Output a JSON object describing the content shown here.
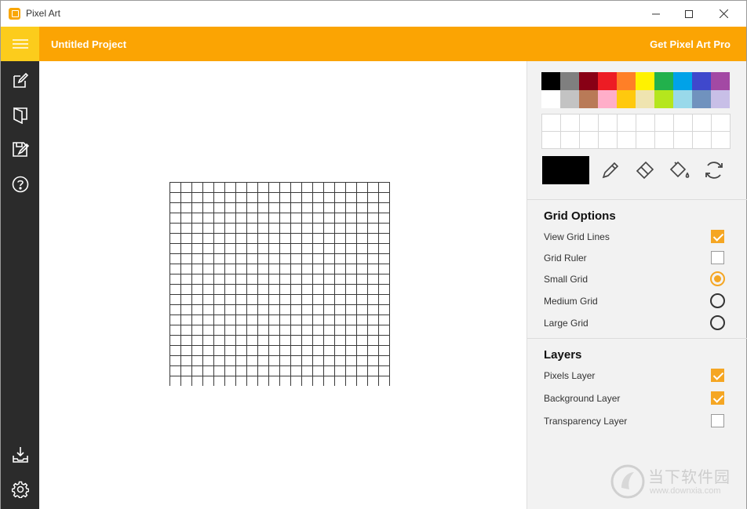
{
  "window": {
    "title": "Pixel Art",
    "controls": {
      "minimize": "minimize-icon",
      "maximize": "maximize-icon",
      "close": "close-icon"
    }
  },
  "header": {
    "menu_icon": "hamburger-menu-icon",
    "project_title": "Untitled Project",
    "pro_link": "Get Pixel Art Pro"
  },
  "sidebar": {
    "items": [
      {
        "icon": "edit-icon"
      },
      {
        "icon": "open-book-icon"
      },
      {
        "icon": "save-icon"
      },
      {
        "icon": "help-icon"
      },
      {
        "icon": "download-icon"
      },
      {
        "icon": "settings-gear-icon"
      }
    ]
  },
  "canvas": {
    "grid_columns": 20,
    "grid_rows": 20
  },
  "palette": {
    "colors": [
      "#000000",
      "#7f7f7f",
      "#880015",
      "#ed1c24",
      "#ff7f27",
      "#fff200",
      "#22b14c",
      "#00a2e8",
      "#3f48cc",
      "#a349a4",
      "#ffffff",
      "#c3c3c3",
      "#b97a57",
      "#ffaec9",
      "#ffc90e",
      "#efe4b0",
      "#b5e61d",
      "#99d9ea",
      "#7092be",
      "#c8bfe7"
    ],
    "current_color": "#000000"
  },
  "tools": [
    {
      "icon": "pencil-icon"
    },
    {
      "icon": "eraser-icon"
    },
    {
      "icon": "fill-bucket-icon"
    },
    {
      "icon": "refresh-icon"
    }
  ],
  "grid_options": {
    "title": "Grid Options",
    "view_grid_lines": {
      "label": "View Grid Lines",
      "checked": true
    },
    "grid_ruler": {
      "label": "Grid Ruler",
      "checked": false
    },
    "small_grid": {
      "label": "Small Grid",
      "selected": true
    },
    "medium_grid": {
      "label": "Medium Grid",
      "selected": false
    },
    "large_grid": {
      "label": "Large Grid",
      "selected": false
    }
  },
  "layers": {
    "title": "Layers",
    "pixels_layer": {
      "label": "Pixels Layer",
      "checked": true
    },
    "background_layer": {
      "label": "Background Layer",
      "checked": true
    },
    "transparency_layer": {
      "label": "Transparency Layer",
      "checked": false
    }
  },
  "watermark": {
    "text_cn": "当下软件园",
    "url": "www.downxia.com"
  },
  "colors": {
    "accent": "#fba403",
    "menu_button": "#fccc1c",
    "sidebar": "#2b2b2b",
    "panel": "#f2f2f2"
  }
}
